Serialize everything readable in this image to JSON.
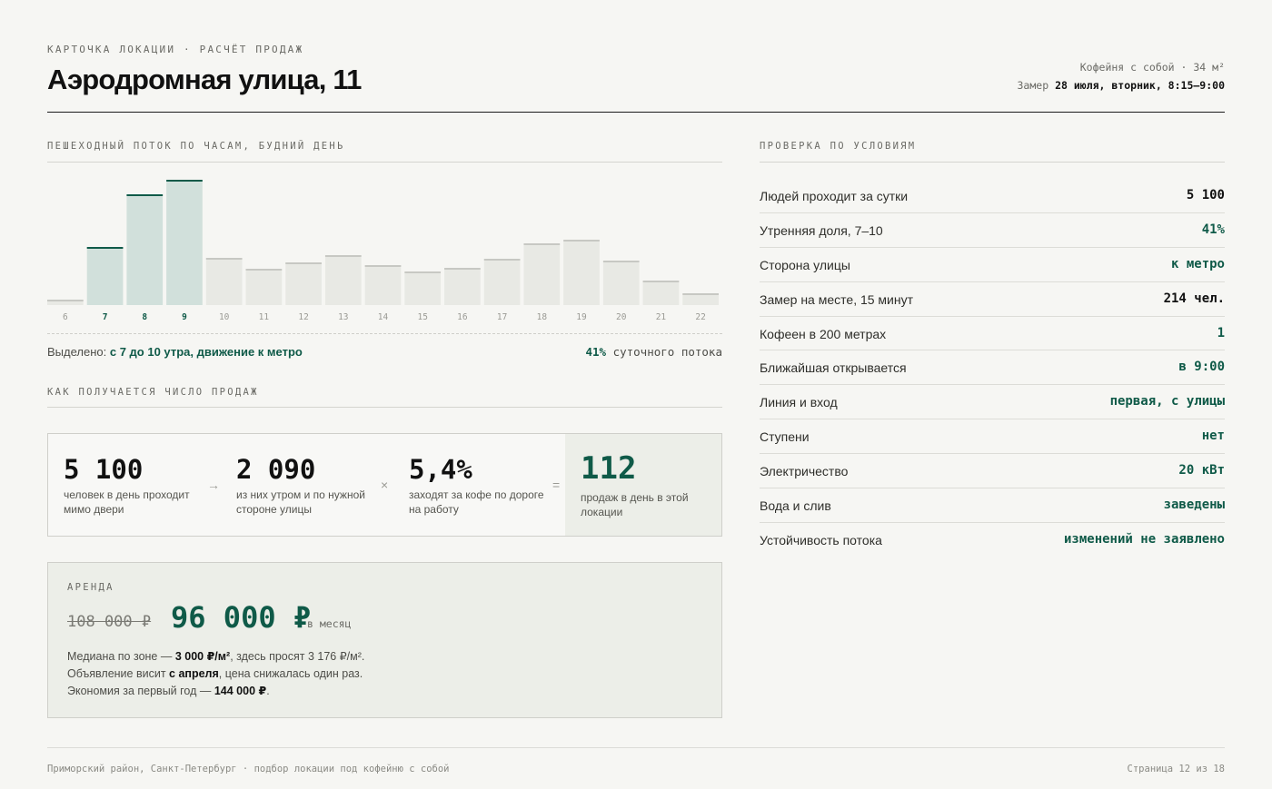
{
  "header": {
    "eyebrow": "КАРТОЧКА ЛОКАЦИИ · РАСЧЁТ ПРОДАЖ",
    "title": "Аэродромная улица, 11",
    "meta_line1": "Кофейня с собой · 34 м²",
    "meta_prefix": "Замер",
    "meta_date": "28 июля, вторник, 8:15–9:00"
  },
  "flow": {
    "label": "ПЕШЕХОДНЫЙ ПОТОК ПО ЧАСАМ, БУДНИЙ ДЕНЬ",
    "highlight_prefix": "Выделено:",
    "highlight_text": "с 7 до 10 утра, движение к метро",
    "share_value": "41%",
    "share_text": "суточного потока"
  },
  "chart_data": {
    "type": "bar",
    "categories": [
      "6",
      "7",
      "8",
      "9",
      "10",
      "11",
      "12",
      "13",
      "14",
      "15",
      "16",
      "17",
      "18",
      "19",
      "20",
      "21",
      "22"
    ],
    "values": [
      6,
      64,
      122,
      138,
      52,
      40,
      47,
      55,
      44,
      37,
      41,
      51,
      68,
      72,
      49,
      27,
      13
    ],
    "highlighted": [
      "7",
      "8",
      "9"
    ],
    "ylim": [
      0,
      140
    ],
    "colors": {
      "highlight_fill": "#d1e0db",
      "highlight_top": "#0f5a48",
      "normal_fill": "#e8e9e4",
      "normal_top": "#c7c8c3"
    }
  },
  "sales": {
    "label": "КАК ПОЛУЧАЕТСЯ ЧИСЛО ПРОДАЖ",
    "steps": [
      {
        "value": "5 100",
        "desc": "человек в день проходит мимо двери",
        "op": "→"
      },
      {
        "value": "2 090",
        "desc": "из них утром и по нужной стороне улицы",
        "op": "×"
      },
      {
        "value": "5,4%",
        "desc": "заходят за кофе по дороге на работу",
        "op": "="
      }
    ],
    "result": {
      "value": "112",
      "desc": "продаж в день в этой локации"
    }
  },
  "rent": {
    "label": "АРЕНДА",
    "old_price": "108 000 ₽",
    "new_price": "96 000 ₽",
    "per": "в месяц",
    "line1_a": "Медиана по зоне —",
    "line1_b": "3 000 ₽/м²",
    "line1_c": ", здесь просят 3 176 ₽/м².",
    "line2_a": "Объявление висит",
    "line2_b": "с апреля",
    "line2_c": ", цена снижалась один раз.",
    "line3_a": "Экономия за первый год —",
    "line3_b": "144 000 ₽",
    "line3_c": "."
  },
  "checks": {
    "label": "ПРОВЕРКА ПО УСЛОВИЯМ",
    "rows": [
      {
        "label": "Людей проходит за сутки",
        "value": "5 100"
      },
      {
        "label": "Утренняя доля, 7–10",
        "value": "41%"
      },
      {
        "label": "Сторона улицы",
        "value": "к метро"
      },
      {
        "label": "Замер на месте, 15 минут",
        "value": "214 чел."
      },
      {
        "label": "Кофеен в 200 метрах",
        "value": "1"
      },
      {
        "label": "Ближайшая открывается",
        "value": "в 9:00"
      },
      {
        "label": "Линия и вход",
        "value": "первая, с улицы"
      },
      {
        "label": "Ступени",
        "value": "нет"
      },
      {
        "label": "Электричество",
        "value": "20 кВт"
      },
      {
        "label": "Вода и слив",
        "value": "заведены"
      },
      {
        "label": "Устойчивость потока",
        "value": "изменений не заявлено"
      }
    ]
  },
  "footer": {
    "left": "Приморский район, Санкт-Петербург · подбор локации под кофейню с собой",
    "right": "Страница 12 из 18"
  }
}
